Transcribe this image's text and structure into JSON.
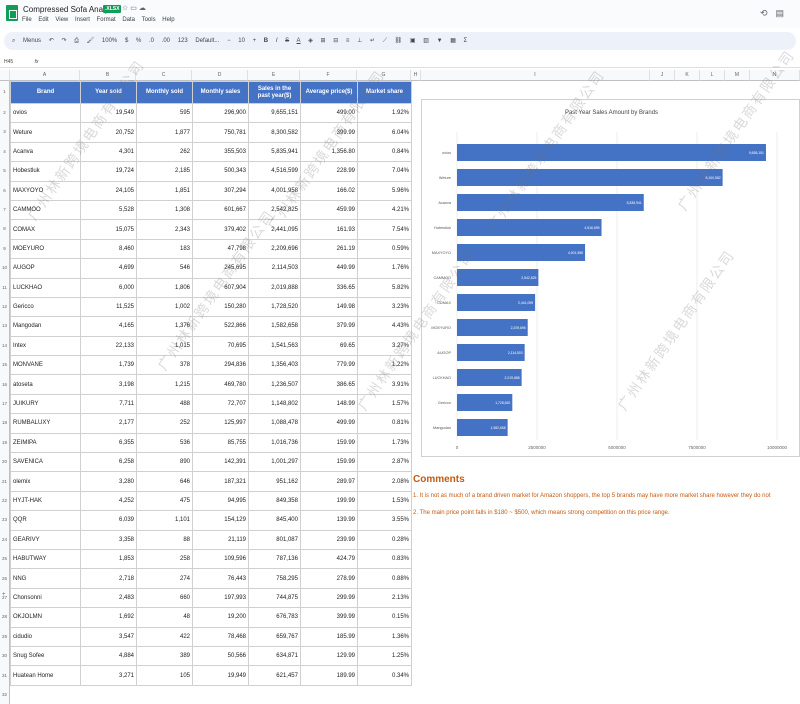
{
  "app": {
    "doc_title": "Compressed Sofa Analysis",
    "badge": ".XLSX",
    "menus": [
      "File",
      "Edit",
      "View",
      "Insert",
      "Format",
      "Data",
      "Tools",
      "Help"
    ]
  },
  "toolbar": {
    "menus_label": "Menus",
    "zoom": "100%",
    "currency": "$",
    "percent": "%",
    "font_name": "Default...",
    "font_size": "10",
    "bold": "B",
    "italic": "I",
    "strike": "S",
    "text_color": "A"
  },
  "cell_ref": "H45",
  "columns": [
    "A",
    "B",
    "C",
    "D",
    "E",
    "F",
    "G",
    "H",
    "I",
    "J",
    "K",
    "L",
    "M",
    "N"
  ],
  "table": {
    "headers": [
      "Brand",
      "Year sold",
      "Monthly sold",
      "Monthly sales",
      "Sales in the past year($)",
      "Average price($)",
      "Market share"
    ],
    "rows": [
      [
        "ovios",
        "19,549",
        "595",
        "296,900",
        "9,655,151",
        "499.00",
        "1.92%"
      ],
      [
        "Weture",
        "20,752",
        "1,877",
        "750,781",
        "8,300,582",
        "399.99",
        "6.04%"
      ],
      [
        "Acanva",
        "4,301",
        "262",
        "355,503",
        "5,835,941",
        "1,356.80",
        "0.84%"
      ],
      [
        "Hobestluk",
        "19,724",
        "2,185",
        "500,343",
        "4,516,599",
        "228.99",
        "7.04%"
      ],
      [
        "MAXYOYO",
        "24,105",
        "1,851",
        "307,294",
        "4,001,958",
        "166.02",
        "5.96%"
      ],
      [
        "CAMMOO",
        "5,528",
        "1,308",
        "601,667",
        "2,542,825",
        "459.99",
        "4.21%"
      ],
      [
        "COMAX",
        "15,075",
        "2,343",
        "379,402",
        "2,441,095",
        "161.93",
        "7.54%"
      ],
      [
        "MOEYURO",
        "8,460",
        "183",
        "47,798",
        "2,209,696",
        "261.19",
        "0.59%"
      ],
      [
        "AUGOP",
        "4,699",
        "546",
        "245,695",
        "2,114,503",
        "449.99",
        "1.76%"
      ],
      [
        "LUCKHAO",
        "6,000",
        "1,806",
        "607,904",
        "2,019,888",
        "336.65",
        "5.82%"
      ],
      [
        "Gericco",
        "11,525",
        "1,002",
        "150,280",
        "1,728,520",
        "149.98",
        "3.23%"
      ],
      [
        "Mangodan",
        "4,165",
        "1,376",
        "522,866",
        "1,582,658",
        "379.99",
        "4.43%"
      ],
      [
        "Intex",
        "22,133",
        "1,015",
        "70,695",
        "1,541,563",
        "69.65",
        "3.27%"
      ],
      [
        "MONVANE",
        "1,739",
        "378",
        "294,836",
        "1,356,403",
        "779.99",
        "1.22%"
      ],
      [
        "atoseta",
        "3,198",
        "1,215",
        "469,780",
        "1,236,507",
        "386.65",
        "3.91%"
      ],
      [
        "JUIKURY",
        "7,711",
        "488",
        "72,707",
        "1,148,802",
        "148.99",
        "1.57%"
      ],
      [
        "RUMBALUXY",
        "2,177",
        "252",
        "125,997",
        "1,088,478",
        "499.99",
        "0.81%"
      ],
      [
        "ZEIMIPA",
        "6,355",
        "536",
        "85,755",
        "1,016,736",
        "159.99",
        "1.73%"
      ],
      [
        "SAVENICA",
        "6,258",
        "890",
        "142,391",
        "1,001,297",
        "159.99",
        "2.87%"
      ],
      [
        "olemix",
        "3,280",
        "646",
        "187,321",
        "951,162",
        "289.97",
        "2.08%"
      ],
      [
        "HYJT-HAK",
        "4,252",
        "475",
        "94,995",
        "849,358",
        "199.99",
        "1.53%"
      ],
      [
        "QQR",
        "6,039",
        "1,101",
        "154,129",
        "845,400",
        "139.99",
        "3.55%"
      ],
      [
        "GEARIVY",
        "3,358",
        "88",
        "21,119",
        "801,087",
        "239.99",
        "0.28%"
      ],
      [
        "HABUTWAY",
        "1,853",
        "258",
        "109,596",
        "787,136",
        "424.79",
        "0.83%"
      ],
      [
        "NNG",
        "2,718",
        "274",
        "76,443",
        "758,295",
        "278.99",
        "0.88%"
      ],
      [
        "Chonsonni",
        "2,483",
        "660",
        "197,993",
        "744,875",
        "299.99",
        "2.13%"
      ],
      [
        "OKJOLMN",
        "1,692",
        "48",
        "19,200",
        "676,783",
        "399.99",
        "0.15%"
      ],
      [
        "cidudio",
        "3,547",
        "422",
        "78,468",
        "659,767",
        "185.99",
        "1.36%"
      ],
      [
        "Snug Sofee",
        "4,884",
        "389",
        "50,566",
        "634,871",
        "129.99",
        "1.25%"
      ],
      [
        "Huatean Home",
        "3,271",
        "105",
        "19,949",
        "621,457",
        "189.99",
        "0.34%"
      ]
    ]
  },
  "chart_data": {
    "type": "bar",
    "orientation": "horizontal",
    "title": "Past Year Sales Amount by Brands",
    "categories": [
      "ovios",
      "Weture",
      "Acanva",
      "Hobestluk",
      "MAXYOYO",
      "CAMMOO",
      "COMAX",
      "MOEYURO",
      "AUGOP",
      "LUCKHAO",
      "Gericco",
      "Mangodan"
    ],
    "values": [
      9655151,
      8300582,
      5835941,
      4516599,
      4001958,
      2542825,
      2441095,
      2209696,
      2114503,
      2019888,
      1728520,
      1582658
    ],
    "data_labels": [
      "9,655,151",
      "8,300,582",
      "5,835,941",
      "4,516,599",
      "4,001,958",
      "2,542,825",
      "2,441,095",
      "2,209,696",
      "2,114,503",
      "2,019,888",
      "1,728,520",
      "1,582,658"
    ],
    "x_ticks": [
      0,
      2500000,
      5000000,
      7500000,
      10000000
    ],
    "x_tick_labels": [
      "0",
      "2500000",
      "5000000",
      "7500000",
      "10000000"
    ],
    "xlim": [
      0,
      10000000
    ],
    "bar_color": "#4472c4",
    "grid": true
  },
  "comments": {
    "title": "Comments",
    "items": [
      "1. It is not as much of a brand driven market for Amazon shoppers, the top 5 brands may have more market share however they do not",
      "2. The main price point falls in $180 ~ $500, which means strong competition on this price range."
    ]
  },
  "watermark": "广州林新跨境电商有限公司"
}
